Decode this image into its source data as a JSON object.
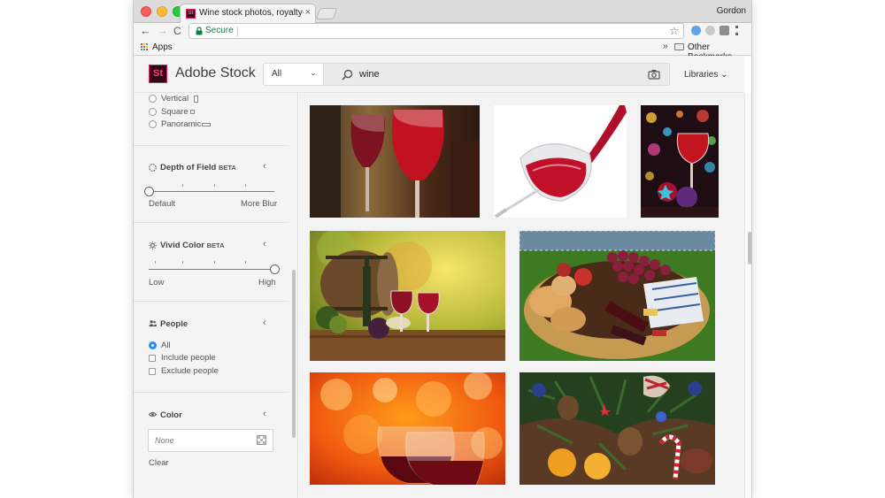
{
  "browser": {
    "tab_title": "Wine stock photos, royalty-free",
    "tab_close": "×",
    "favicon_text": "St",
    "profile_name": "Gordon",
    "nav_back": "←",
    "nav_forward": "→",
    "nav_reload": "C",
    "secure_label": "Secure",
    "star": "☆",
    "bookmarks": {
      "apps_label": "Apps",
      "more": "»",
      "other_label": "Other Bookmarks"
    }
  },
  "header": {
    "logo_text": "St",
    "brand": "Adobe Stock",
    "search": {
      "scope": "All",
      "scope_chevron": "⌄",
      "query": "wine"
    },
    "libraries": "Libraries ⌄"
  },
  "sidebar": {
    "orientation": {
      "options": [
        {
          "label": "Vertical",
          "selected": false
        },
        {
          "label": "Square",
          "selected": false
        },
        {
          "label": "Panoramic",
          "selected": false
        }
      ]
    },
    "depth_of_field": {
      "title": "Depth of Field",
      "badge": "BETA",
      "chevron": "‹",
      "min_label": "Default",
      "max_label": "More Blur",
      "value": 0
    },
    "vivid_color": {
      "title": "Vivid Color",
      "badge": "BETA",
      "chevron": "‹",
      "min_label": "Low",
      "max_label": "High",
      "value": 1
    },
    "people": {
      "title": "People",
      "chevron": "‹",
      "options": [
        {
          "label": "All",
          "selected": true
        },
        {
          "label": "Include people",
          "selected": false
        },
        {
          "label": "Exclude people",
          "selected": false
        }
      ]
    },
    "color": {
      "title": "Color",
      "chevron": "‹",
      "field_value": "None",
      "clear_label": "Clear"
    }
  },
  "results": {
    "images": [
      {
        "subject": "red-wine-glasses-in-cellar"
      },
      {
        "subject": "wine-pouring-into-glass"
      },
      {
        "subject": "wine-glass-christmas-bokeh"
      },
      {
        "subject": "wine-barrel-grapes-two-glasses"
      },
      {
        "subject": "picnic-basket-grapes-bread-wine"
      },
      {
        "subject": "wine-glasses-orange-bokeh"
      },
      {
        "subject": "christmas-table-pine-cones-candy-canes"
      }
    ]
  },
  "colors": {
    "accent_blue": "#2d8ceb",
    "secure_green": "#0b8043",
    "stock_logo_bg": "#330613",
    "stock_logo_pink": "#e51e63"
  }
}
